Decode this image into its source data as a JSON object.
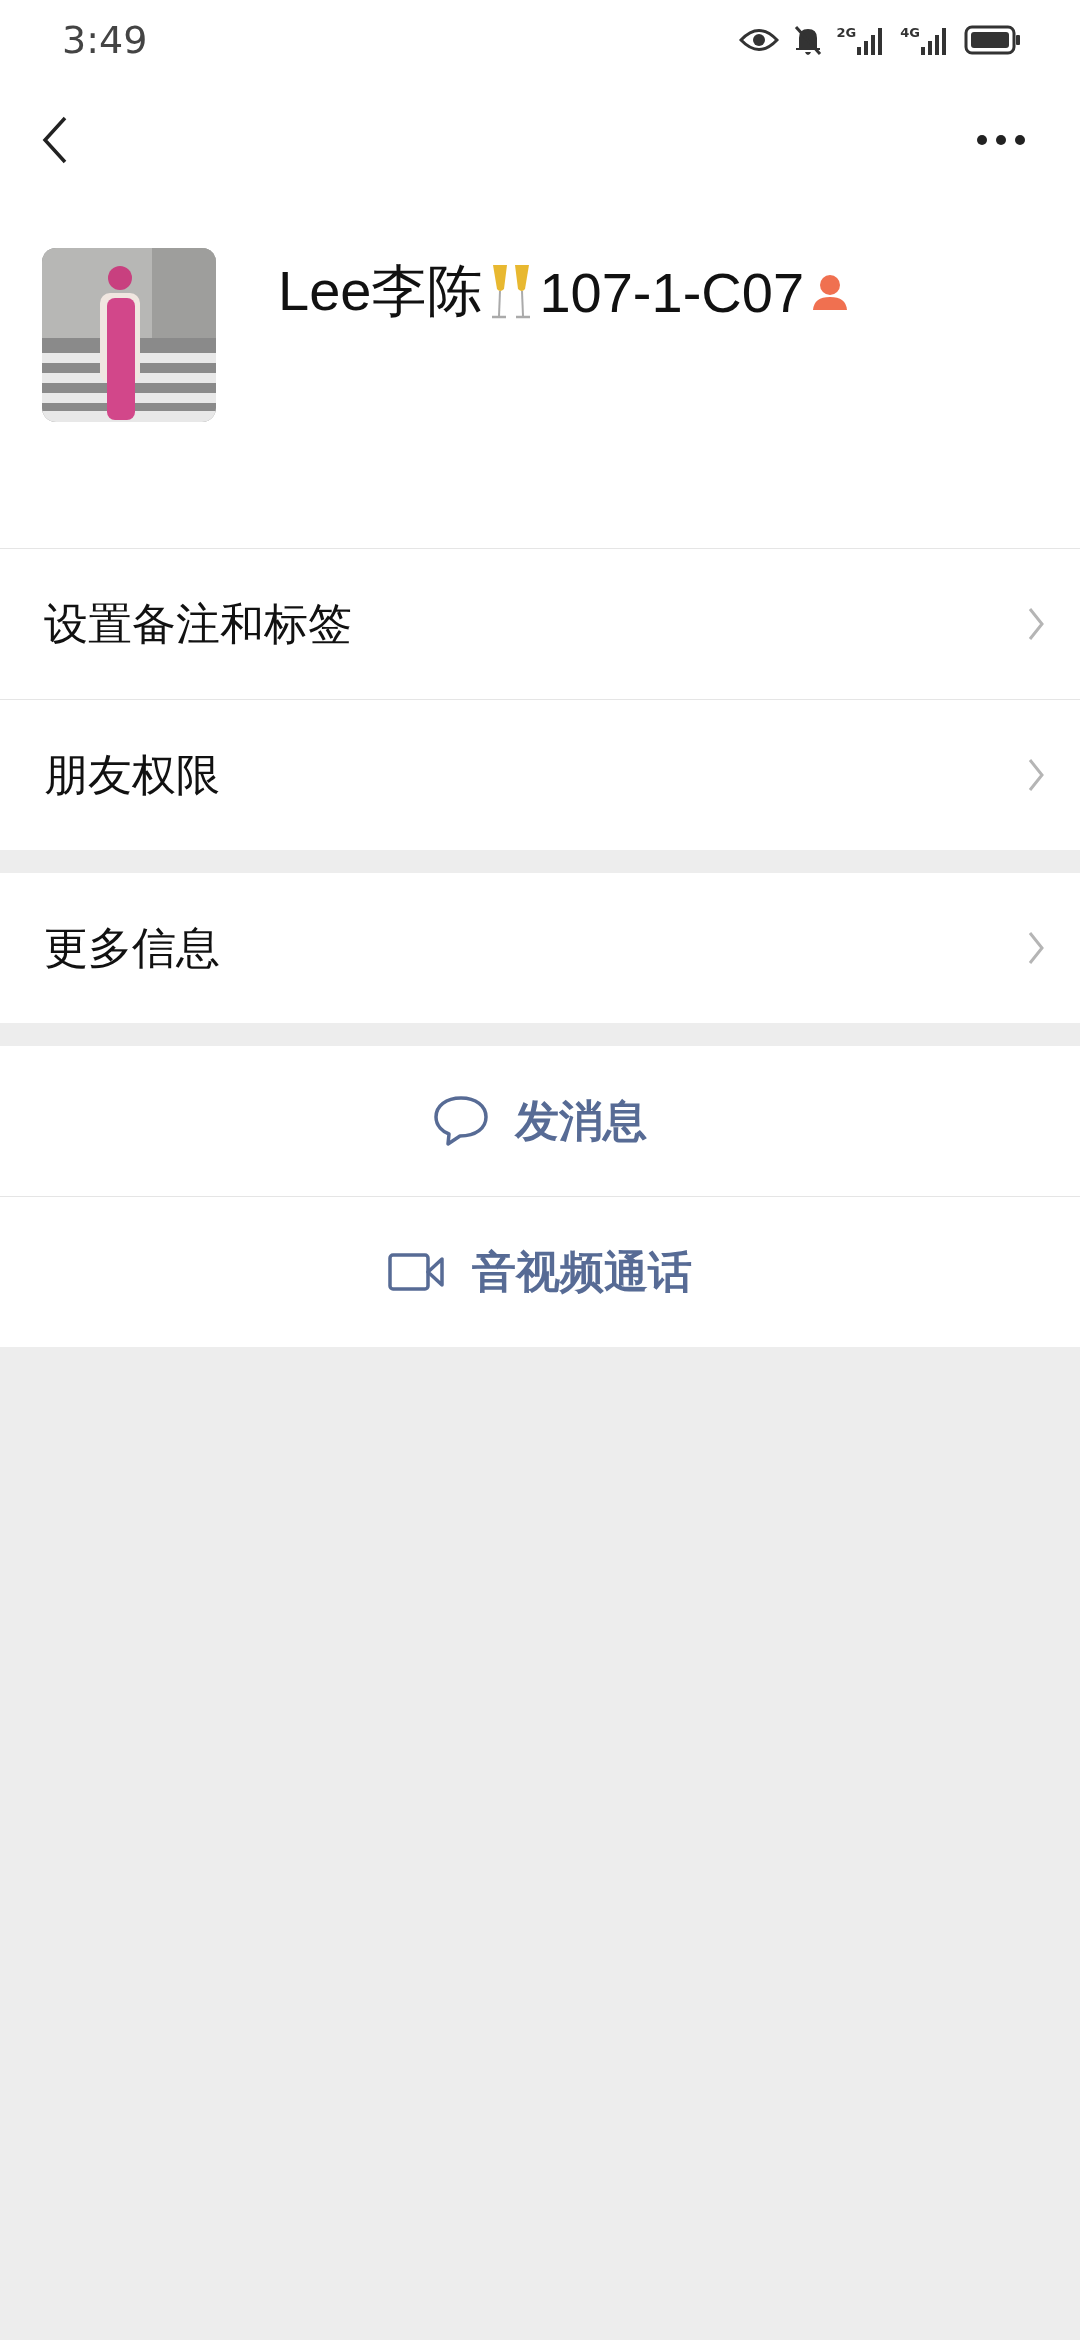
{
  "status_bar": {
    "time": "3:49",
    "network_1": "2G",
    "network_2": "4G"
  },
  "profile": {
    "name": "Lee李陈",
    "code": "107-1-C07"
  },
  "menu_groups": [
    {
      "items": [
        {
          "label": "设置备注和标签"
        },
        {
          "label": "朋友权限"
        }
      ]
    },
    {
      "items": [
        {
          "label": "更多信息"
        }
      ]
    }
  ],
  "actions": [
    {
      "kind": "message",
      "label": "发消息"
    },
    {
      "kind": "video",
      "label": "音视频通话"
    }
  ]
}
